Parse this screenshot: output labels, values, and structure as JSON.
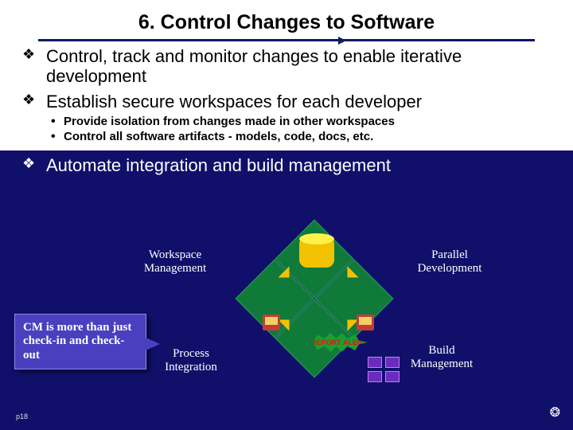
{
  "title": "6. Control Changes to Software",
  "bullets_level1": [
    "Control, track and monitor changes to enable iterative development",
    "Establish secure workspaces for each developer"
  ],
  "bullets_level2": [
    "Provide isolation from changes made in other workspaces",
    "Control all software artifacts - models, code, docs, etc."
  ],
  "bullet_dark": "Automate integration and build management",
  "diagram": {
    "top_left": "Workspace Management",
    "top_right": "Parallel Development",
    "bottom_left": "Process Integration",
    "bottom_right": "Build Management",
    "alert": "REPORT ALERT"
  },
  "callout": "CM is more than just check-in and check-out",
  "page_number": "p18",
  "gear_icon": "❂"
}
